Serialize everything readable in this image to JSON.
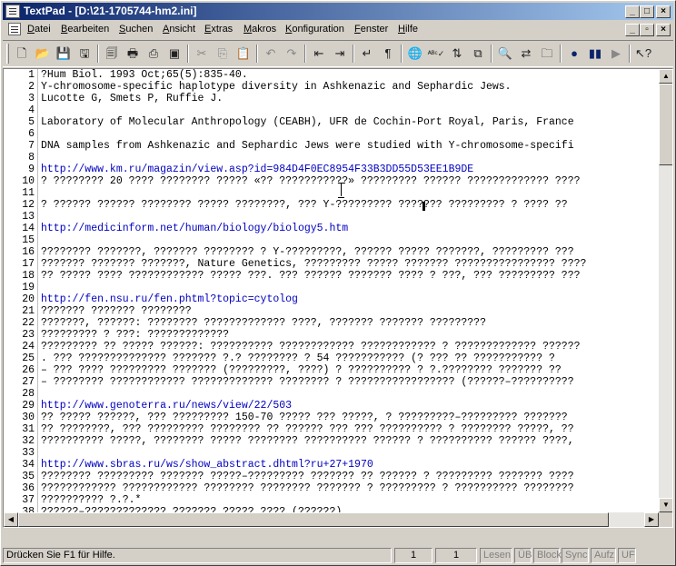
{
  "window": {
    "title": "TextPad - [D:\\21-1705744-hm2.ini]"
  },
  "menu": {
    "items": [
      "Datei",
      "Bearbeiten",
      "Suchen",
      "Ansicht",
      "Extras",
      "Makros",
      "Konfiguration",
      "Fenster",
      "Hilfe"
    ]
  },
  "toolbar": {
    "buttons": [
      "new-file",
      "open-file",
      "save",
      "save-all",
      "print-preview",
      "print",
      "print-setup",
      "document-properties",
      "cut",
      "copy",
      "paste",
      "undo",
      "redo",
      "decrease-indent",
      "increase-indent",
      "word-wrap",
      "show-paragraph",
      "web-browser",
      "spelling",
      "sort",
      "compare",
      "find",
      "replace",
      "find-in-files",
      "record-macro",
      "pause-macro",
      "play-macro",
      "context-help"
    ]
  },
  "editor": {
    "lines": [
      {
        "n": "1",
        "text": "?Hum Biol. 1993 Oct;65(5):835-40."
      },
      {
        "n": "2",
        "text": "Y-chromosome-specific haplotype diversity in Ashkenazic and Sephardic Jews."
      },
      {
        "n": "3",
        "text": "Lucotte G, Smets P, Ruffie J."
      },
      {
        "n": "4",
        "text": ""
      },
      {
        "n": "5",
        "text": "Laboratory of Molecular Anthropology (CEABH), UFR de Cochin-Port Royal, Paris, France"
      },
      {
        "n": "6",
        "text": ""
      },
      {
        "n": "7",
        "text": "DNA samples from Ashkenazic and Sephardic Jews were studied with Y-chromosome-specifi"
      },
      {
        "n": "8",
        "text": ""
      },
      {
        "n": "9",
        "text": "http://www.km.ru/magazin/view.asp?id=984D4F0EC8954F33B3DD55D53EE1B9DE",
        "link": true
      },
      {
        "n": "10",
        "text": "? ???????? 20 ???? ???????? ????? «?? ???????????» ????????? ?????? ????????????? ????"
      },
      {
        "n": "11",
        "text": ""
      },
      {
        "n": "12",
        "text": "? ?????? ?????? ???????? ????? ????????, ??? Y-????????? ??????? ????????? ? ???? ??"
      },
      {
        "n": "13",
        "text": ""
      },
      {
        "n": "14",
        "text": "http://medicinform.net/human/biology/biology5.htm",
        "link": true
      },
      {
        "n": "15",
        "text": ""
      },
      {
        "n": "16",
        "text": "???????? ???????, ??????? ???????? ? Y-?????????, ?????? ????? ???????, ????????? ???"
      },
      {
        "n": "17",
        "text": "??????? ??????? ???????, Nature Genetics, ????????? ????? ??????? ???????????????? ????"
      },
      {
        "n": "18",
        "text": "?? ????? ???? ???????????? ????? ???. ??? ?????? ??????? ???? ? ???, ??? ????????? ???"
      },
      {
        "n": "19",
        "text": ""
      },
      {
        "n": "20",
        "text": "http://fen.nsu.ru/fen.phtml?topic=cytolog",
        "link": true
      },
      {
        "n": "21",
        "text": "??????? ??????? ????????"
      },
      {
        "n": "22",
        "text": "???????, ??????: ???????? ????????????? ????, ??????? ??????? ?????????"
      },
      {
        "n": "23",
        "text": "????????? ? ???: ?????????????"
      },
      {
        "n": "24",
        "text": "????????? ?? ????? ??????: ?????????? ???????????? ???????????? ? ????????????? ??????"
      },
      {
        "n": "25",
        "text": ". ??? ?????????????? ??????? ?.? ???????? ? 54 ??????????? (? ??? ?? ??????????? ?"
      },
      {
        "n": "26",
        "text": "– ??? ???? ????????? ??????? (?????????, ????) ? ?????????? ? ?.???????? ??????? ??"
      },
      {
        "n": "27",
        "text": "– ???????? ???????????? ????????????? ???????? ? ????????????????? (??????–??????????"
      },
      {
        "n": "28",
        "text": ""
      },
      {
        "n": "29",
        "text": "http://www.genoterra.ru/news/view/22/503",
        "link": true
      },
      {
        "n": "30",
        "text": "?? ????? ??????, ??? ????????? 150-70 ????? ??? ?????, ? ?????????–????????? ???????"
      },
      {
        "n": "31",
        "text": "?? ????????, ??? ????????? ???????? ?? ?????? ??? ??? ?????????? ? ???????? ?????, ??"
      },
      {
        "n": "32",
        "text": "?????????? ?????, ???????? ????? ???????? ?????????? ?????? ? ?????????? ?????? ????,"
      },
      {
        "n": "33",
        "text": ""
      },
      {
        "n": "34",
        "text": "http://www.sbras.ru/ws/show_abstract.dhtml?ru+27+1970",
        "link": true
      },
      {
        "n": "35",
        "text": "???????? ????????? ??????? ?????–????????? ??????? ?? ?????? ? ????????? ??????? ????"
      },
      {
        "n": "36",
        "text": "???????????? ???????????? ???????? ???????? ??????? ? ????????? ? ?????????? ????????"
      },
      {
        "n": "37",
        "text": "?????????? ?.?.*"
      },
      {
        "n": "38",
        "text": "??????–????????????? ??????? ????? ???? (??????)"
      }
    ]
  },
  "statusbar": {
    "hint": "Drücken Sie F1 für Hilfe.",
    "line": "1",
    "column": "1",
    "indicators": [
      "Lesen",
      "ÜB",
      "Block",
      "Sync",
      "Aufz",
      "UF"
    ]
  }
}
